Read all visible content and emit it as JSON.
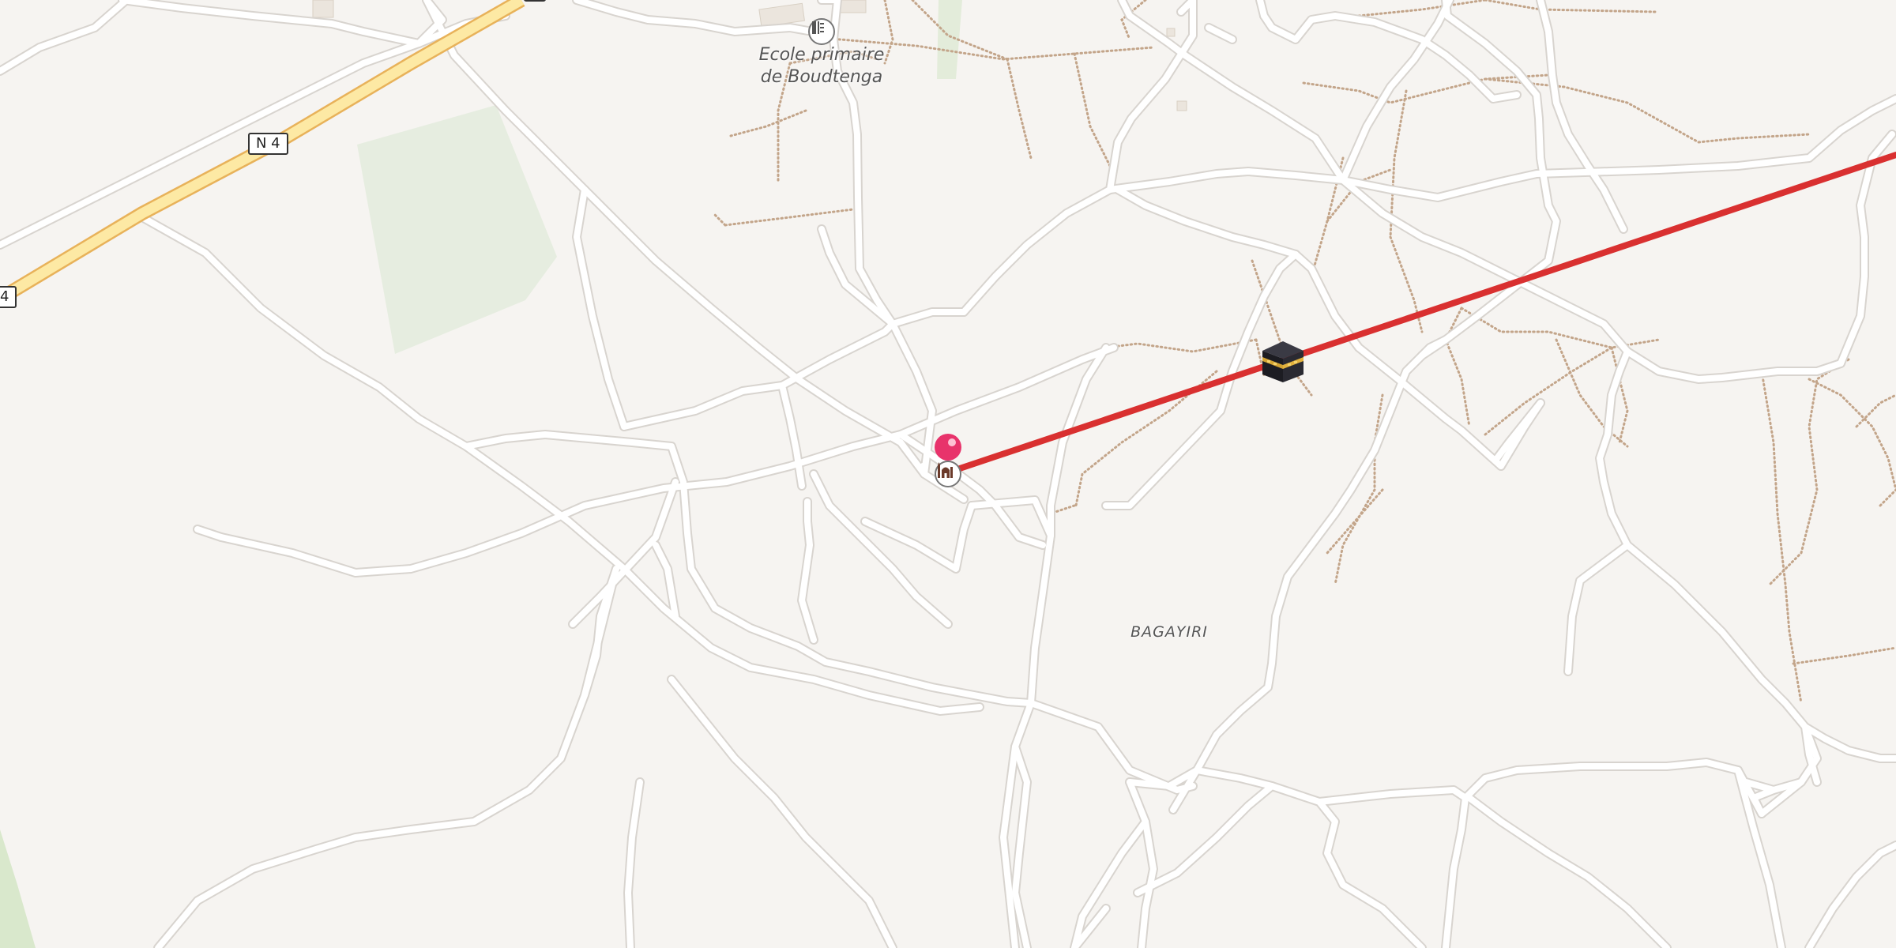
{
  "map": {
    "road_shields": [
      {
        "label": "N 4"
      },
      {
        "label": "4"
      }
    ],
    "labels": {
      "school_line1": "Ecole primaire",
      "school_line2": "de Boudtenga",
      "locality": "BAGAYIRI"
    },
    "icons": {
      "school_poi": "school-icon",
      "mosque_poi": "mosque-icon",
      "location_pin": "location-pin-icon",
      "kaaba": "kaaba-icon"
    },
    "colors": {
      "background": "#f6f4f1",
      "road": "#ffffff",
      "road_casing": "#d8d4cf",
      "highway_fill": "#fde9a4",
      "highway_casing": "#e8b25a",
      "track": "#c3a58a",
      "park": "#e6ede0",
      "qibla_line": "#d93030",
      "pin": "#e8336b"
    }
  }
}
